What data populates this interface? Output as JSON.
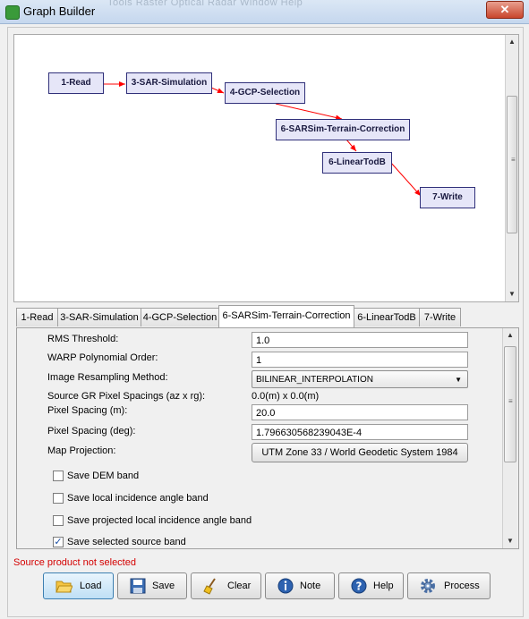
{
  "window": {
    "title": "Graph Builder",
    "close_glyph": "✕",
    "menu_ghost": "Tools    Raster    Optical    Radar    Window    Help",
    "icon": "graph-builder-app-icon"
  },
  "graph": {
    "nodes": [
      {
        "id": "read",
        "label": "1-Read"
      },
      {
        "id": "sarsim",
        "label": "3-SAR-Simulation"
      },
      {
        "id": "gcp",
        "label": "4-GCP-Selection"
      },
      {
        "id": "terrain",
        "label": "6-SARSim-Terrain-Correction"
      },
      {
        "id": "lineartodb",
        "label": "6-LinearTodB"
      },
      {
        "id": "write",
        "label": "7-Write"
      }
    ],
    "edge_color": "#ff0000",
    "node_border": "#30307a",
    "node_fill": "#e6e6f8"
  },
  "tabs": [
    {
      "label": "1-Read"
    },
    {
      "label": "3-SAR-Simulation"
    },
    {
      "label": "4-GCP-Selection"
    },
    {
      "label": "6-SARSim-Terrain-Correction",
      "active": true
    },
    {
      "label": "6-LinearTodB"
    },
    {
      "label": "7-Write"
    }
  ],
  "params": {
    "rms_threshold_label": "RMS Threshold:",
    "rms_threshold_value": "1.0",
    "warp_order_label": "WARP Polynomial Order:",
    "warp_order_value": "1",
    "resampling_label": "Image Resampling Method:",
    "resampling_value": "BILINEAR_INTERPOLATION",
    "source_spacing_label": "Source GR Pixel Spacings (az x rg):",
    "source_spacing_value": "0.0(m) x 0.0(m)",
    "pixel_spacing_m_label": "Pixel Spacing (m):",
    "pixel_spacing_m_value": "20.0",
    "pixel_spacing_deg_label": "Pixel Spacing (deg):",
    "pixel_spacing_deg_value": "1.796630568239043E-4",
    "map_projection_label": "Map Projection:",
    "map_projection_value": "UTM Zone 33 / World Geodetic System 1984",
    "checkboxes": [
      {
        "label": "Save DEM band",
        "checked": false
      },
      {
        "label": "Save local incidence angle band",
        "checked": false
      },
      {
        "label": "Save projected local incidence angle band",
        "checked": false
      },
      {
        "label": "Save selected source band",
        "checked": true
      }
    ]
  },
  "status": {
    "message": "Source product not selected",
    "color": "#d40000"
  },
  "buttons": [
    {
      "label": "Load",
      "icon": "folder-open-icon"
    },
    {
      "label": "Save",
      "icon": "floppy-disk-icon"
    },
    {
      "label": "Clear",
      "icon": "broom-icon"
    },
    {
      "label": "Note",
      "icon": "info-icon"
    },
    {
      "label": "Help",
      "icon": "help-icon"
    },
    {
      "label": "Process",
      "icon": "gear-icon"
    }
  ]
}
